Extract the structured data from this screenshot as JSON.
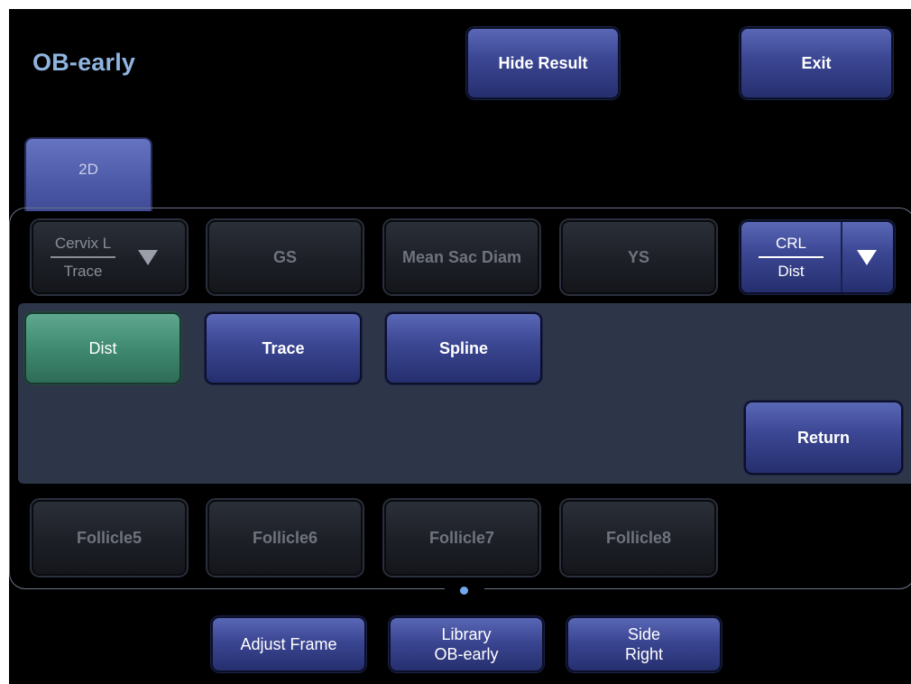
{
  "header": {
    "title": "OB-early",
    "hide_result": "Hide Result",
    "exit": "Exit"
  },
  "tab": {
    "label": "2D"
  },
  "methods_row": {
    "cervix": {
      "top": "Cervix L",
      "bottom": "Trace"
    },
    "gs": "GS",
    "mean_sac": "Mean Sac Diam",
    "ys": "YS",
    "crl": {
      "top": "CRL",
      "bottom": "Dist"
    }
  },
  "tools": {
    "dist": "Dist",
    "trace": "Trace",
    "spline": "Spline",
    "return": "Return"
  },
  "follicles": [
    "Follicle5",
    "Follicle6",
    "Follicle7",
    "Follicle8"
  ],
  "bottom_bar": {
    "adjust_frame": "Adjust Frame",
    "library": {
      "label": "Library",
      "value": "OB-early"
    },
    "side": {
      "label": "Side",
      "value": "Right"
    }
  },
  "colors": {
    "accent_blue": "#3b4692",
    "active_green": "#3f8a70",
    "title": "#8fb4df"
  }
}
